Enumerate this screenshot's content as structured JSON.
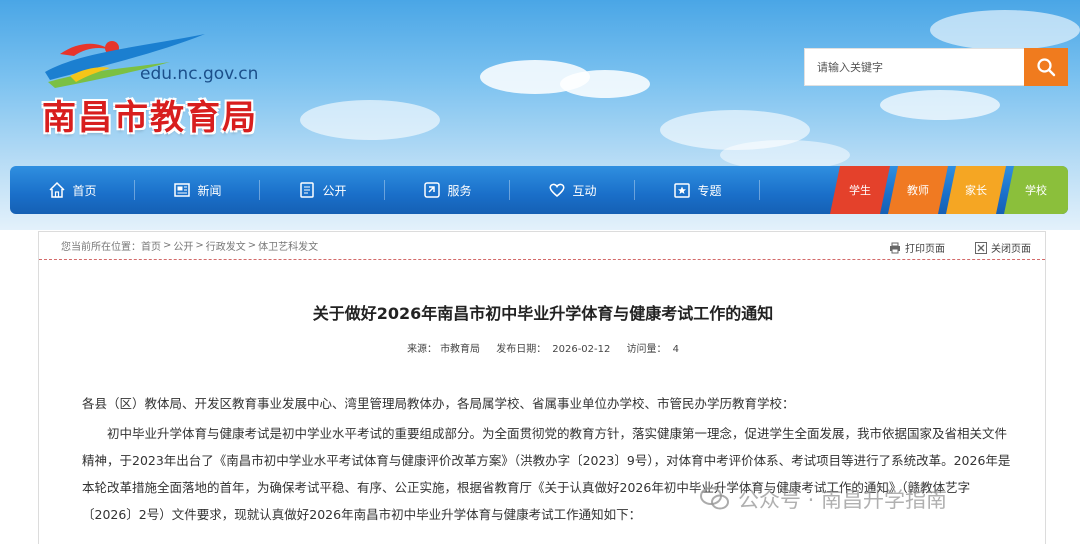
{
  "site": {
    "domain": "edu.nc.gov.cn",
    "name": "南昌市教育局"
  },
  "search": {
    "placeholder": "请输入关键字",
    "icon": "search-icon"
  },
  "nav": {
    "items": [
      {
        "label": "首页",
        "icon": "home-icon"
      },
      {
        "label": "新闻",
        "icon": "news-icon"
      },
      {
        "label": "公开",
        "icon": "document-icon"
      },
      {
        "label": "服务",
        "icon": "service-icon"
      },
      {
        "label": "互动",
        "icon": "heart-icon"
      },
      {
        "label": "专题",
        "icon": "star-icon"
      }
    ],
    "roles": [
      {
        "label": "学生",
        "color": "#e4412b"
      },
      {
        "label": "教师",
        "color": "#f07a22"
      },
      {
        "label": "家长",
        "color": "#f5a623"
      },
      {
        "label": "学校",
        "color": "#8bbf3b"
      }
    ]
  },
  "breadcrumb": {
    "prefix": "您当前所在位置：",
    "items": [
      "首页",
      "公开",
      "行政发文",
      "体卫艺科发文"
    ],
    "separator": ">"
  },
  "tools": {
    "print": "打印页面",
    "close": "关闭页面"
  },
  "article": {
    "title": "关于做好2026年南昌市初中毕业升学体育与健康考试工作的通知",
    "source_label": "来源：",
    "source": "市教育局",
    "date_label": "发布日期：",
    "date": "2026-02-12",
    "visits_label": "访问量：",
    "visits": "4",
    "paragraphs": [
      "各县（区）教体局、开发区教育事业发展中心、湾里管理局教体办，各局属学校、省属事业单位办学校、市管民办学历教育学校：",
      "初中毕业升学体育与健康考试是初中学业水平考试的重要组成部分。为全面贯彻党的教育方针，落实健康第一理念，促进学生全面发展，我市依据国家及省相关文件精神，于2023年出台了《南昌市初中学业水平考试体育与健康评价改革方案》（洪教办字〔2023〕9号），对体育中考评价体系、考试项目等进行了系统改革。2026年是本轮改革措施全面落地的首年，为确保考试平稳、有序、公正实施，根据省教育厅《关于认真做好2026年初中毕业升学体育与健康考试工作的通知》（赣教体艺字〔2026〕2号）文件要求，现就认真做好2026年南昌市初中毕业升学体育与健康考试工作通知如下："
    ]
  },
  "watermark": {
    "text": "公众号 · 南昌升学指南",
    "icon": "wechat-icon"
  },
  "colors": {
    "nav_blue": "#1a6fc9",
    "search_orange": "#f07b1e",
    "title_red": "#d81e1e"
  }
}
